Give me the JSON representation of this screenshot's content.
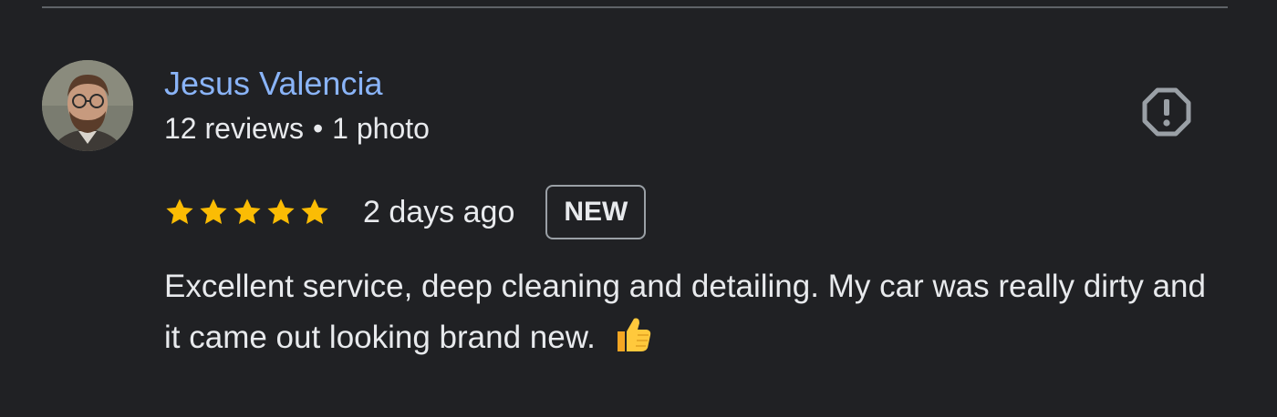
{
  "review": {
    "reviewer_name": "Jesus Valencia",
    "reviews_count": "12 reviews",
    "meta_separator": "•",
    "photos_count": "1 photo",
    "rating": 5,
    "rating_max": 5,
    "date": "2 days ago",
    "badge": "NEW",
    "text": "Excellent service, deep cleaning and detailing. My car was really dirty and it came out looking brand new.",
    "emoji_icon": "thumbs-up-icon"
  },
  "icons": {
    "report": "report-flag-icon",
    "star": "star-icon",
    "avatar": "avatar-photo"
  },
  "colors": {
    "background": "#202124",
    "name": "#8ab4f8",
    "text": "#e8eaed",
    "star": "#fbbc04",
    "divider": "#5f6368",
    "badge_border": "#9aa0a6"
  }
}
